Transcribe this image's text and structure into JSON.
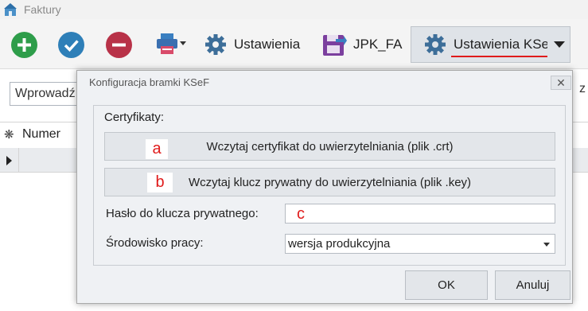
{
  "window": {
    "title": "Faktury"
  },
  "toolbar": {
    "settings_label": "Ustawienia",
    "jpk_label": "JPK_FA",
    "ksef_label": "Ustawienia KSeF"
  },
  "main": {
    "search_placeholder": "Wprowadź",
    "grid": {
      "columns": [
        "Numer"
      ]
    }
  },
  "dialog": {
    "title": "Konfiguracja bramki KSeF",
    "group_label": "Certyfikaty:",
    "load_cert_label": "Wczytaj certyfikat do uwierzytelniania (plik .crt)",
    "load_key_label": "Wczytaj klucz prywatny do uwierzytelniania (plik .key)",
    "password_label": "Hasło do klucza prywatnego:",
    "password_value": "",
    "env_label": "Środowisko pracy:",
    "env_value": "wersja produkcyjna",
    "ok_label": "OK",
    "cancel_label": "Anuluj",
    "markers": {
      "a": "a",
      "b": "b",
      "c": "c"
    }
  },
  "colors": {
    "accent_red": "#e01b1b",
    "add_green": "#2e9d4a",
    "check_blue": "#2e7fb8",
    "remove_red": "#b83248"
  }
}
